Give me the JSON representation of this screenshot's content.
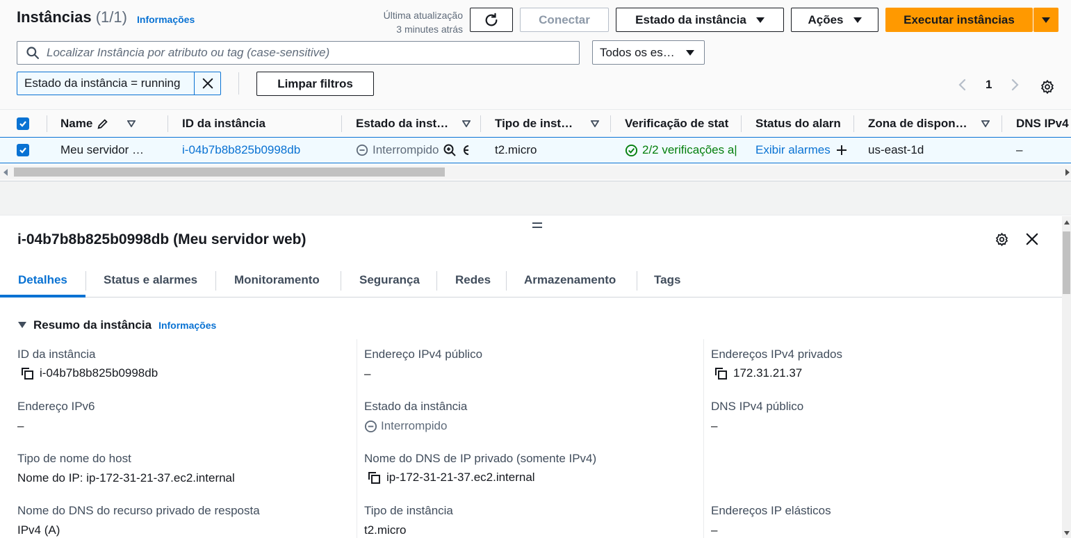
{
  "header": {
    "title": "Instâncias",
    "count": "(1/1)",
    "info_link": "Informações",
    "last_update_label": "Última atualização",
    "last_update_value": "3 minutes atrás",
    "connect_label": "Conectar",
    "instance_state_label": "Estado da instância",
    "actions_label": "Ações",
    "launch_label": "Executar instâncias"
  },
  "search": {
    "placeholder": "Localizar Instância por atributo ou tag (case-sensitive)",
    "filter_select": "Todos os es…"
  },
  "filters": {
    "token": "Estado da instância = running",
    "clear_label": "Limpar filtros"
  },
  "pagination": {
    "page": "1"
  },
  "table": {
    "columns": [
      "Name",
      "ID da instância",
      "Estado da inst…",
      "Tipo de inst…",
      "Verificação de stat",
      "Status do alarn",
      "Zona de dispon…",
      "DNS IPv4"
    ],
    "row": {
      "name": "Meu servidor …",
      "instance_id": "i-04b7b8b825b0998db",
      "state": "Interrompido",
      "type": "t2.micro",
      "status_check": "2/2 verificações a|",
      "alarm_status": "Exibir alarmes",
      "zone": "us-east-1d",
      "dns": "–"
    }
  },
  "details": {
    "title": "i-04b7b8b825b0998db (Meu servidor web)",
    "tabs": [
      "Detalhes",
      "Status e alarmes",
      "Monitoramento",
      "Segurança",
      "Redes",
      "Armazenamento",
      "Tags"
    ],
    "section_title": "Resumo da instância",
    "section_info": "Informações",
    "fields": {
      "instance_id_label": "ID da instância",
      "instance_id_value": "i-04b7b8b825b0998db",
      "public_ipv4_label": "Endereço IPv4 público",
      "public_ipv4_value": "–",
      "private_ipv4_label": "Endereços IPv4 privados",
      "private_ipv4_value": "172.31.21.37",
      "ipv6_label": "Endereço IPv6",
      "ipv6_value": "–",
      "state_label": "Estado da instância",
      "state_value": "Interrompido",
      "public_dns_label": "DNS IPv4 público",
      "public_dns_value": "–",
      "hostname_type_label": "Tipo de nome do host",
      "hostname_type_value": "Nome do IP: ip-172-31-21-37.ec2.internal",
      "private_dns_label": "Nome do DNS de IP privado (somente IPv4)",
      "private_dns_value": "ip-172-31-21-37.ec2.internal",
      "resource_dns_label": "Nome do DNS do recurso privado de resposta",
      "resource_dns_value": "IPv4 (A)",
      "instance_type_label": "Tipo de instância",
      "instance_type_value": "t2.micro",
      "elastic_ip_label": "Endereços IP elásticos",
      "elastic_ip_value": "–"
    }
  },
  "colors": {
    "accent": "#0972d3",
    "primary": "#ff9900",
    "success": "#037f0c"
  }
}
